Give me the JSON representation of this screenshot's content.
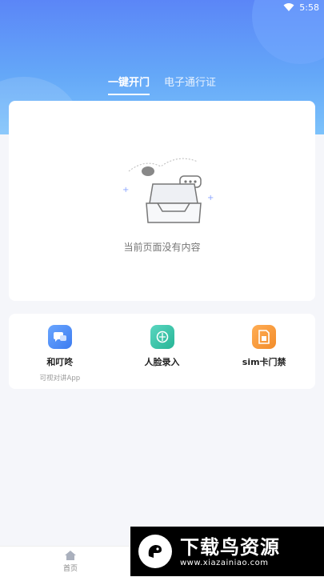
{
  "status_bar": {
    "time": "5:58"
  },
  "tabs": [
    {
      "label": "一键开门",
      "active": true
    },
    {
      "label": "电子通行证",
      "active": false
    }
  ],
  "empty_state": {
    "message": "当前页面没有内容"
  },
  "actions": [
    {
      "label": "和叮咚",
      "sublabel": "可视对讲App",
      "icon": "chat-bubbles-icon",
      "color": "#3d7cf0"
    },
    {
      "label": "人脸录入",
      "icon": "face-shield-icon",
      "color": "#27b596"
    },
    {
      "label": "sim卡门禁",
      "icon": "sim-card-icon",
      "color": "#f28c2a"
    }
  ],
  "bottom_nav": {
    "home_label": "首页"
  },
  "watermark": {
    "title": "下载鸟资源",
    "url": "www.xiazainiao.com"
  },
  "colors": {
    "header_top": "#5b86f7",
    "header_bottom": "#7cc2fb",
    "background": "#f5f6fa"
  }
}
